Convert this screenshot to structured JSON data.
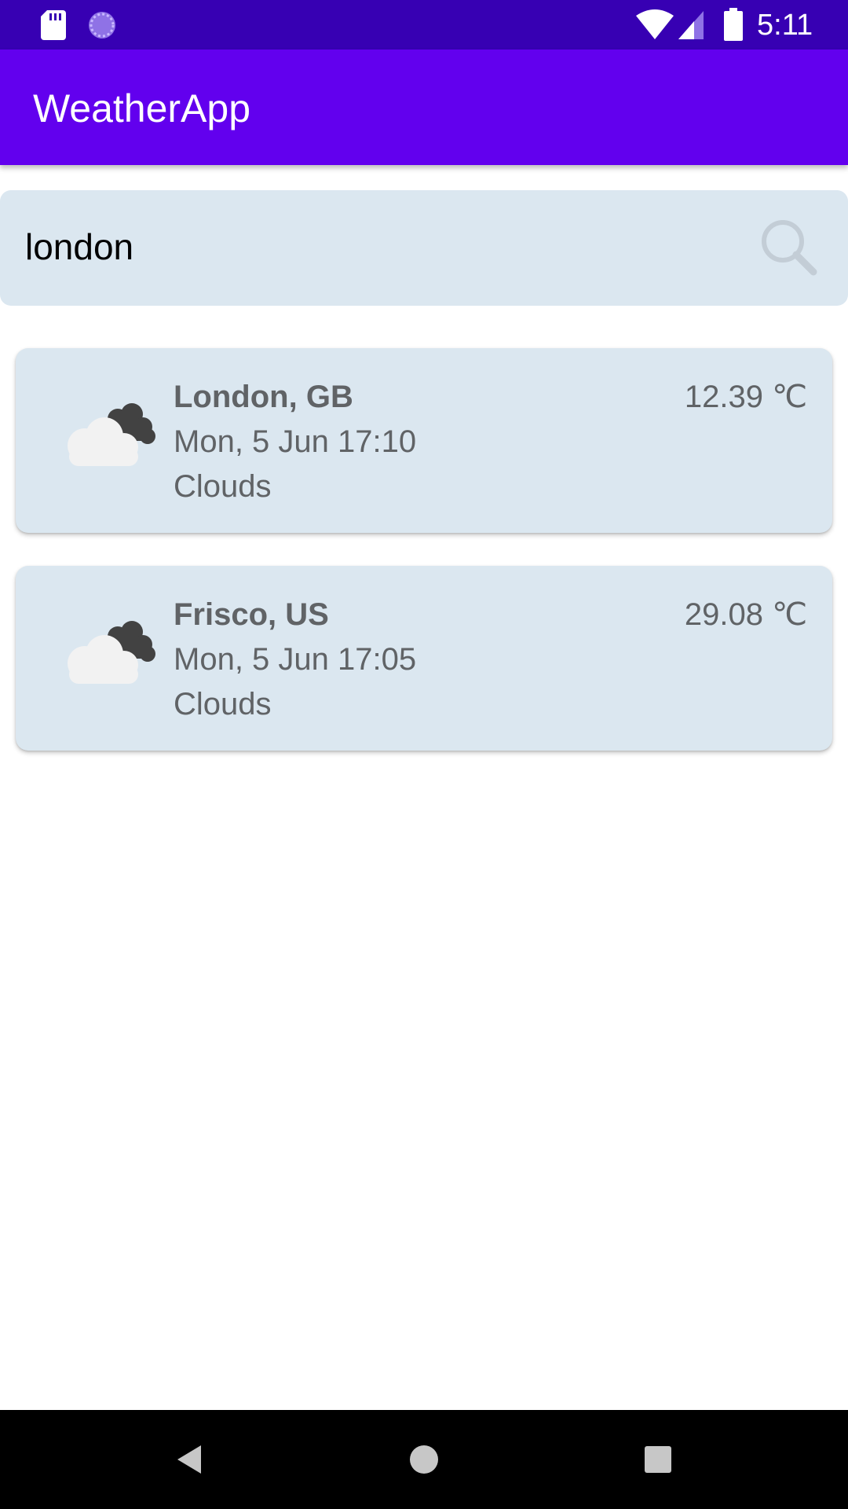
{
  "status_bar": {
    "time": "5:11",
    "icons": [
      "sd-card-icon",
      "sync-icon",
      "wifi-icon",
      "cell-signal-icon",
      "battery-icon"
    ]
  },
  "app_bar": {
    "title": "WeatherApp",
    "color": "#6200ee"
  },
  "search": {
    "value": "london",
    "icon": "search-icon"
  },
  "results": [
    {
      "city": "London, GB",
      "datetime": "Mon, 5 Jun 17:10",
      "condition": "Clouds",
      "temperature": "12.39 ℃",
      "icon": "clouds-icon"
    },
    {
      "city": "Frisco, US",
      "datetime": "Mon, 5 Jun 17:05",
      "condition": "Clouds",
      "temperature": "29.08 ℃",
      "icon": "clouds-icon"
    }
  ],
  "nav_bar": {
    "buttons": [
      "back-icon",
      "home-icon",
      "recents-icon"
    ]
  },
  "colors": {
    "status_bar": "#3700b3",
    "card_background": "#dbe7f0",
    "card_text": "#606366"
  }
}
